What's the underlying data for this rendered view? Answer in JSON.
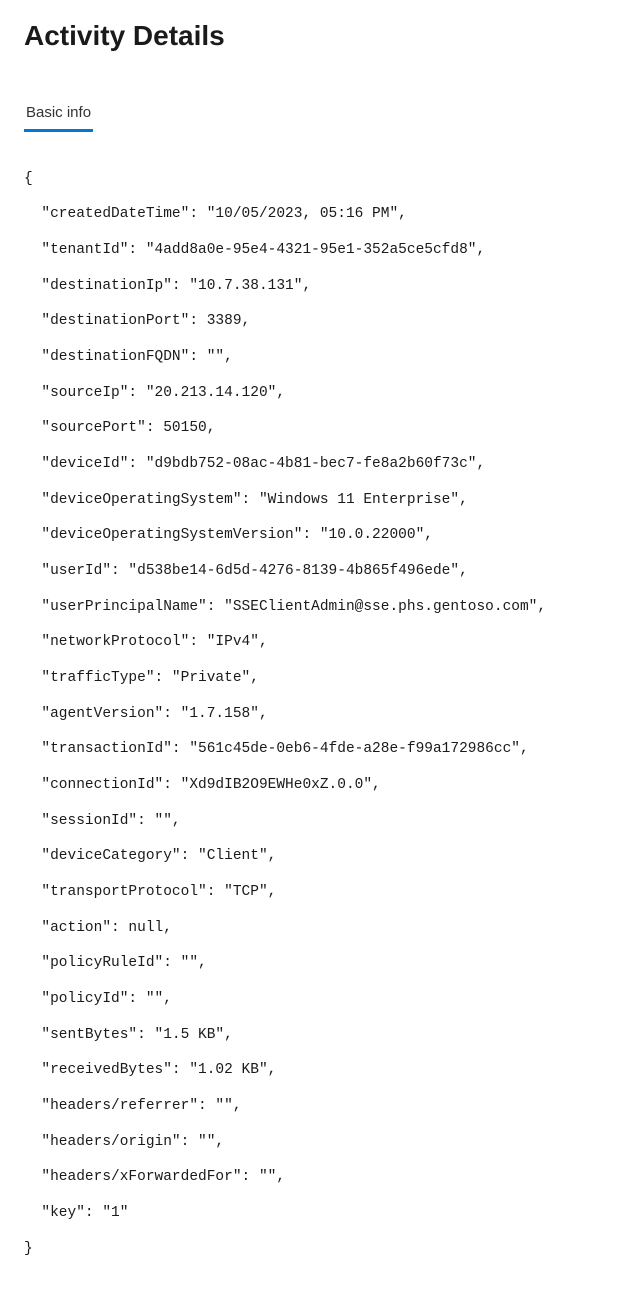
{
  "pageTitle": "Activity Details",
  "tabs": {
    "basicInfo": "Basic info"
  },
  "jsonOpenBrace": "{",
  "jsonCloseBrace": "}",
  "fields": {
    "createdDateTime": "  \"createdDateTime\": \"10/05/2023, 05:16 PM\",",
    "tenantId": "  \"tenantId\": \"4add8a0e-95e4-4321-95e1-352a5ce5cfd8\",",
    "destinationIp": "  \"destinationIp\": \"10.7.38.131\",",
    "destinationPort": "  \"destinationPort\": 3389,",
    "destinationFQDN": "  \"destinationFQDN\": \"\",",
    "sourceIp": "  \"sourceIp\": \"20.213.14.120\",",
    "sourcePort": "  \"sourcePort\": 50150,",
    "deviceId": "  \"deviceId\": \"d9bdb752-08ac-4b81-bec7-fe8a2b60f73c\",",
    "deviceOperatingSystem": "  \"deviceOperatingSystem\": \"Windows 11 Enterprise\",",
    "deviceOperatingSystemVersion": "  \"deviceOperatingSystemVersion\": \"10.0.22000\",",
    "userId": "  \"userId\": \"d538be14-6d5d-4276-8139-4b865f496ede\",",
    "userPrincipalName": "  \"userPrincipalName\": \"SSEClientAdmin@sse.phs.gentoso.com\",",
    "networkProtocol": "  \"networkProtocol\": \"IPv4\",",
    "trafficType": "  \"trafficType\": \"Private\",",
    "agentVersion": "  \"agentVersion\": \"1.7.158\",",
    "transactionId": "  \"transactionId\": \"561c45de-0eb6-4fde-a28e-f99a172986cc\",",
    "connectionId": "  \"connectionId\": \"Xd9dIB2O9EWHe0xZ.0.0\",",
    "sessionId": "  \"sessionId\": \"\",",
    "deviceCategory": "  \"deviceCategory\": \"Client\",",
    "transportProtocol": "  \"transportProtocol\": \"TCP\",",
    "action": "  \"action\": null,",
    "policyRuleId": "  \"policyRuleId\": \"\",",
    "policyId": "  \"policyId\": \"\",",
    "sentBytes": "  \"sentBytes\": \"1.5 KB\",",
    "receivedBytes": "  \"receivedBytes\": \"1.02 KB\",",
    "headersReferrer": "  \"headers/referrer\": \"\",",
    "headersOrigin": "  \"headers/origin\": \"\",",
    "headersXForwardedFor": "  \"headers/xForwardedFor\": \"\",",
    "key": "  \"key\": \"1\""
  }
}
